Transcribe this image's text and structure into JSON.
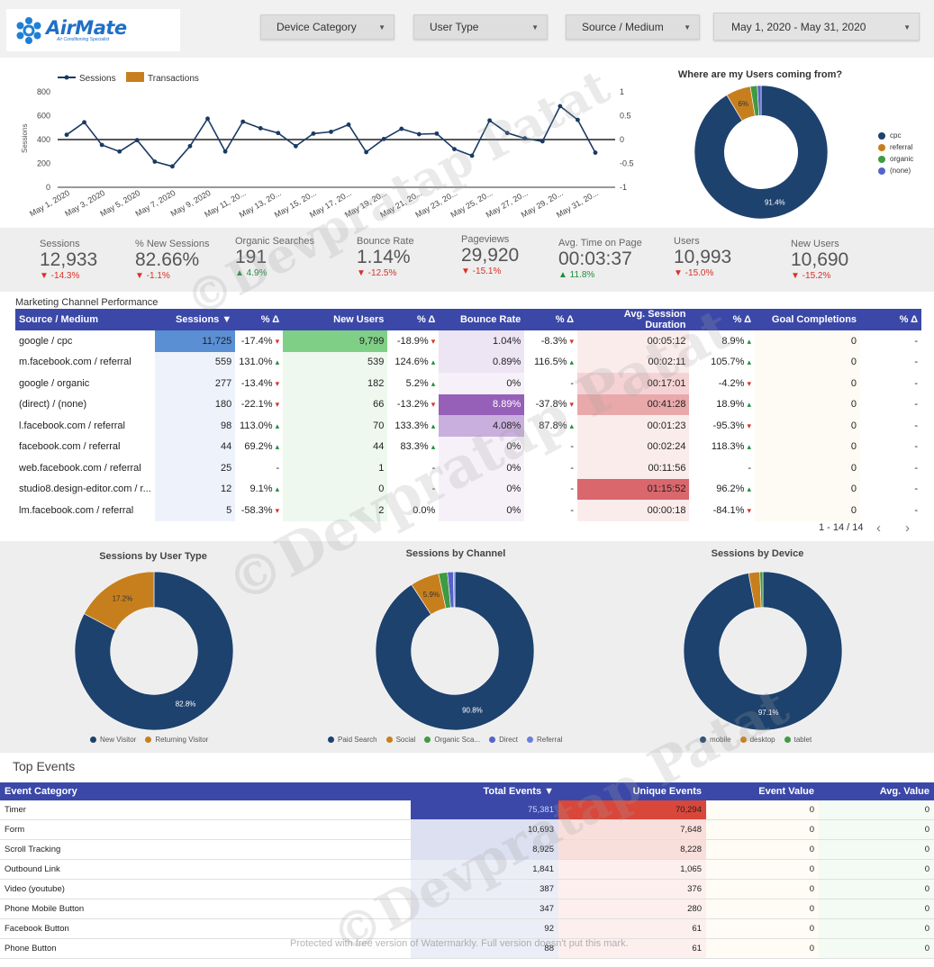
{
  "brand": {
    "name": "AirMate",
    "tagline": "Air Conditioning Specialist"
  },
  "filters": {
    "device_category": "Device Category",
    "user_type": "User Type",
    "source_medium": "Source / Medium",
    "date_range": "May 1, 2020 - May 31, 2020"
  },
  "chart_data": [
    {
      "type": "line",
      "legend": [
        "Sessions",
        "Transactions"
      ],
      "ylabel": "Sessions",
      "ylim": [
        0,
        800
      ],
      "y2lim": [
        -1,
        1
      ],
      "yticks": [
        "800",
        "600",
        "400",
        "200",
        "0"
      ],
      "y2ticks": [
        "1",
        "0.5",
        "0",
        "-0.5",
        "-1"
      ],
      "xtick_labels": [
        "May 1, 2020",
        "May 3, 2020",
        "May 5, 2020",
        "May 7, 2020",
        "May 9, 2020",
        "May 11, 20...",
        "May 13, 20...",
        "May 15, 20...",
        "May 17, 20...",
        "May 19, 20...",
        "May 21, 20...",
        "May 23, 20...",
        "May 25, 20...",
        "May 27, 20...",
        "May 29, 20...",
        "May 31, 20..."
      ],
      "series": [
        {
          "name": "Sessions",
          "color": "#1a3a63",
          "values": [
            440,
            545,
            355,
            300,
            395,
            215,
            175,
            345,
            575,
            300,
            550,
            495,
            455,
            345,
            450,
            465,
            525,
            295,
            405,
            490,
            445,
            450,
            320,
            265,
            560,
            455,
            410,
            385,
            680,
            565,
            290
          ]
        },
        {
          "name": "Transactions",
          "color": "#c77f1e",
          "values": [
            0,
            0,
            0,
            0,
            0,
            0,
            0,
            0,
            0,
            0,
            0,
            0,
            0,
            0,
            0,
            0,
            0,
            0,
            0,
            0,
            0,
            0,
            0,
            0,
            0,
            0,
            0,
            0,
            0,
            0,
            0
          ]
        }
      ]
    },
    {
      "type": "pie",
      "title": "Where are my Users coming from?",
      "categories": [
        "cpc",
        "referral",
        "organic",
        "(none)"
      ],
      "values": [
        91.4,
        6,
        1.7,
        0.9
      ],
      "colors": [
        "#1e426e",
        "#c77f1e",
        "#3f9a44",
        "#5563c9"
      ],
      "labels": [
        "91.4%",
        "6%",
        "",
        ""
      ]
    },
    {
      "type": "pie",
      "title": "Sessions by User Type",
      "categories": [
        "New Visitor",
        "Returning Visitor"
      ],
      "values": [
        82.8,
        17.2
      ],
      "colors": [
        "#1e426e",
        "#c77f1e"
      ],
      "labels": [
        "82.8%",
        "17.2%"
      ]
    },
    {
      "type": "pie",
      "title": "Sessions by Channel",
      "categories": [
        "Paid Search",
        "Social",
        "Organic Sca...",
        "Direct",
        "Referral"
      ],
      "values": [
        90.8,
        5.9,
        1.8,
        1.2,
        0.3
      ],
      "colors": [
        "#1e426e",
        "#c77f1e",
        "#3f9a44",
        "#5563c9",
        "#6a7ee0"
      ],
      "labels": [
        "90.8%",
        "5.9%",
        "",
        "",
        ""
      ]
    },
    {
      "type": "pie",
      "title": "Sessions by Device",
      "categories": [
        "mobile",
        "desktop",
        "tablet"
      ],
      "values": [
        97.1,
        2.3,
        0.6
      ],
      "colors": [
        "#1e426e",
        "#c77f1e",
        "#3f9a44"
      ],
      "labels": [
        "97.1%",
        "",
        ""
      ]
    }
  ],
  "kpis": [
    {
      "label": "Sessions",
      "value": "12,933",
      "change": "-14.3%",
      "dir": "neg"
    },
    {
      "label": "% New Sessions",
      "value": "82.66%",
      "change": "-1.1%",
      "dir": "neg"
    },
    {
      "label": "Organic Searches",
      "value": "191",
      "change": "4.9%",
      "dir": "pos"
    },
    {
      "label": "Bounce Rate",
      "value": "1.14%",
      "change": "-12.5%",
      "dir": "neg"
    },
    {
      "label": "Pageviews",
      "value": "29,920",
      "change": "-15.1%",
      "dir": "neg"
    },
    {
      "label": "Avg. Time on Page",
      "value": "00:03:37",
      "change": "11.8%",
      "dir": "pos"
    },
    {
      "label": "Users",
      "value": "10,993",
      "change": "-15.0%",
      "dir": "neg"
    },
    {
      "label": "New Users",
      "value": "10,690",
      "change": "-15.2%",
      "dir": "neg"
    }
  ],
  "mcp": {
    "title": "Marketing Channel Performance",
    "headers": [
      "Source / Medium",
      "Sessions ▼",
      "% Δ",
      "New Users",
      "% Δ",
      "Bounce Rate",
      "% Δ",
      "Avg. Session Duration",
      "% Δ",
      "Goal Completions",
      "% Δ"
    ],
    "rows": [
      [
        "google / cpc",
        "11,725",
        "-17.4%",
        "9,799",
        "-18.9%",
        "1.04%",
        "-8.3%",
        "00:05:12",
        "8.9%",
        "0",
        "-"
      ],
      [
        "m.facebook.com / referral",
        "559",
        "131.0%",
        "539",
        "124.6%",
        "0.89%",
        "116.5%",
        "00:02:11",
        "105.7%",
        "0",
        "-"
      ],
      [
        "google / organic",
        "277",
        "-13.4%",
        "182",
        "5.2%",
        "0%",
        "-",
        "00:17:01",
        "-4.2%",
        "0",
        "-"
      ],
      [
        "(direct) / (none)",
        "180",
        "-22.1%",
        "66",
        "-13.2%",
        "8.89%",
        "-37.8%",
        "00:41:28",
        "18.9%",
        "0",
        "-"
      ],
      [
        "l.facebook.com / referral",
        "98",
        "113.0%",
        "70",
        "133.3%",
        "4.08%",
        "87.8%",
        "00:01:23",
        "-95.3%",
        "0",
        "-"
      ],
      [
        "facebook.com / referral",
        "44",
        "69.2%",
        "44",
        "83.3%",
        "0%",
        "-",
        "00:02:24",
        "118.3%",
        "0",
        "-"
      ],
      [
        "web.facebook.com / referral",
        "25",
        "-",
        "1",
        "-",
        "0%",
        "-",
        "00:11:56",
        "-",
        "0",
        "-"
      ],
      [
        "studio8.design-editor.com / r...",
        "12",
        "9.1%",
        "0",
        "-",
        "0%",
        "-",
        "01:15:52",
        "96.2%",
        "0",
        "-"
      ],
      [
        "lm.facebook.com / referral",
        "5",
        "-58.3%",
        "2",
        "0.0%",
        "0%",
        "-",
        "00:00:18",
        "-84.1%",
        "0",
        "-"
      ]
    ],
    "pager": "1 - 14 / 14"
  },
  "top_events": {
    "title": "Top Events",
    "headers": [
      "Event Category",
      "Total Events ▼",
      "Unique Events",
      "Event Value",
      "Avg. Value"
    ],
    "rows": [
      [
        "Timer",
        "75,381",
        "70,294",
        "0",
        "0"
      ],
      [
        "Form",
        "10,693",
        "7,648",
        "0",
        "0"
      ],
      [
        "Scroll Tracking",
        "8,925",
        "8,228",
        "0",
        "0"
      ],
      [
        "Outbound Link",
        "1,841",
        "1,065",
        "0",
        "0"
      ],
      [
        "Video (youtube)",
        "387",
        "376",
        "0",
        "0"
      ],
      [
        "Phone Mobile Button",
        "347",
        "280",
        "0",
        "0"
      ],
      [
        "Facebook Button",
        "92",
        "61",
        "0",
        "0"
      ],
      [
        "Phone Button",
        "88",
        "61",
        "0",
        "0"
      ]
    ]
  },
  "watermark": {
    "mark": "©Devpratap Patat",
    "note": "Protected with free version of Watermarkly. Full version doesn't put this mark."
  }
}
